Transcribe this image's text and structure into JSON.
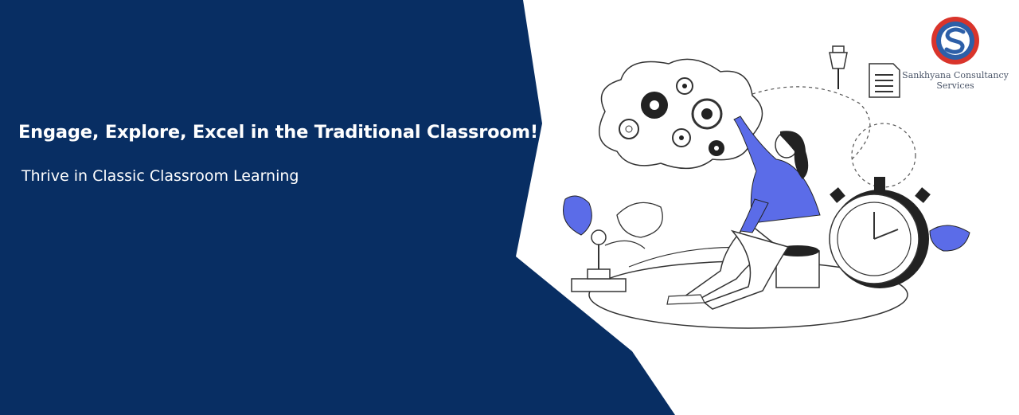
{
  "banner": {
    "headline": "Engage, Explore, Excel in the Traditional Classroom!",
    "subheadline": "Thrive in Classic Classroom Learning"
  },
  "logo": {
    "name": "Sankhyana Consultancy Services",
    "icon": "s-monogram-logo"
  },
  "illustration": {
    "description_icons": [
      "gears-cloud-icon",
      "pushpin-icon",
      "document-icon",
      "stopwatch-icon",
      "joystick-icon",
      "leaf-plant-icon",
      "person-reaching-icon"
    ]
  },
  "colors": {
    "navy_panel": "#082e63",
    "accent_blue": "#5b6ce8",
    "logo_red": "#d9342b",
    "logo_blue": "#2d5fa8",
    "white": "#ffffff"
  }
}
